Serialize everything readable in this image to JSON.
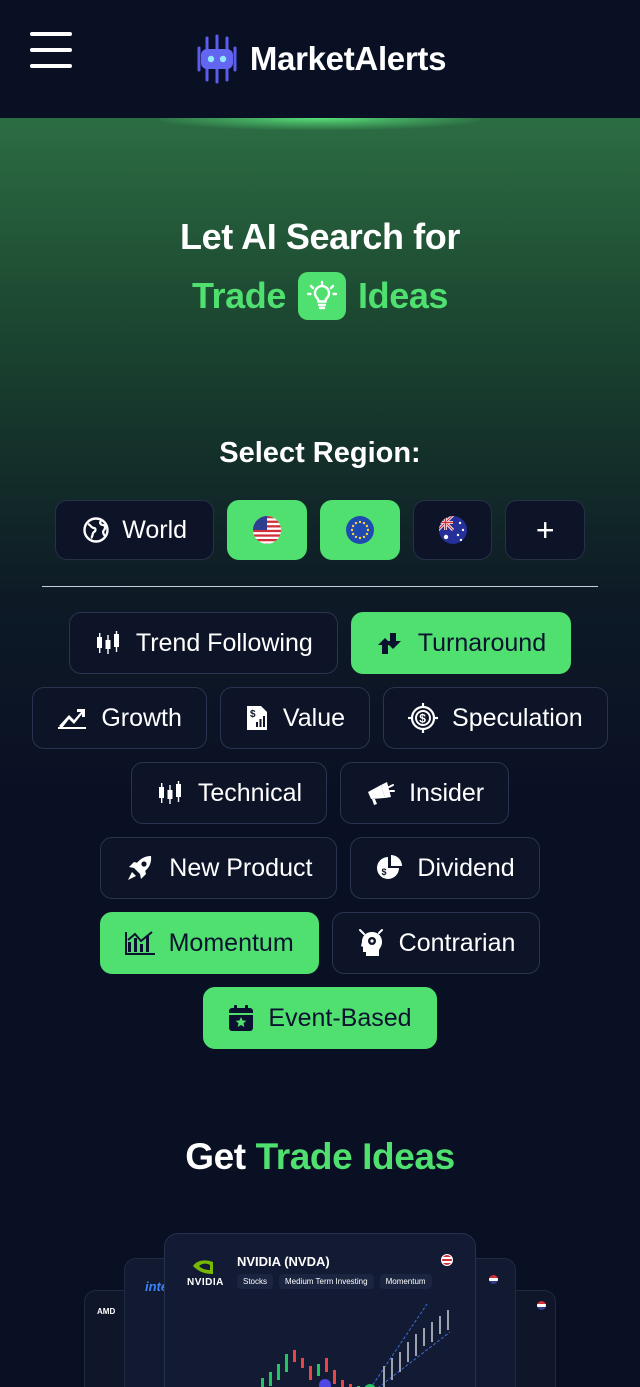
{
  "header": {
    "brand": "MarketAlerts"
  },
  "hero": {
    "line1": "Let AI Search for",
    "word1": "Trade",
    "word2": "Ideas"
  },
  "region": {
    "label": "Select Region:",
    "items": [
      {
        "id": "world",
        "label": "World",
        "icon": "globe-icon",
        "active": false
      },
      {
        "id": "us",
        "icon": "us-flag-icon",
        "active": true
      },
      {
        "id": "eu",
        "icon": "eu-flag-icon",
        "active": true
      },
      {
        "id": "au",
        "icon": "au-flag-icon",
        "active": false
      },
      {
        "id": "more",
        "label": "+",
        "icon": "plus-icon",
        "active": false
      }
    ]
  },
  "strategies": [
    {
      "label": "Trend Following",
      "icon": "candlestick-icon",
      "active": false
    },
    {
      "label": "Turnaround",
      "icon": "turnaround-arrows-icon",
      "active": true
    },
    {
      "label": "Growth",
      "icon": "growth-chart-icon",
      "active": false
    },
    {
      "label": "Value",
      "icon": "value-report-icon",
      "active": false
    },
    {
      "label": "Speculation",
      "icon": "target-dollar-icon",
      "active": false
    },
    {
      "label": "Technical",
      "icon": "candlestick-icon",
      "active": false
    },
    {
      "label": "Insider",
      "icon": "megaphone-icon",
      "active": false
    },
    {
      "label": "New Product",
      "icon": "rocket-icon",
      "active": false
    },
    {
      "label": "Dividend",
      "icon": "dividend-coins-icon",
      "active": false
    },
    {
      "label": "Momentum",
      "icon": "momentum-chart-icon",
      "active": true
    },
    {
      "label": "Contrarian",
      "icon": "contrarian-head-icon",
      "active": false
    },
    {
      "label": "Event-Based",
      "icon": "calendar-star-icon",
      "active": true
    }
  ],
  "get": {
    "prefix": "Get",
    "accent": "Trade Ideas"
  },
  "cards": {
    "main": {
      "logo": "NVIDIA",
      "title": "NVIDIA (NVDA)",
      "tags": [
        "Stocks",
        "Medium Term Investing",
        "Momentum"
      ]
    },
    "left_logo": "intel",
    "far_left_logo": "AMD"
  },
  "colors": {
    "accent": "#4fe06f",
    "background": "#0a1024",
    "chip": "#0d1428"
  }
}
